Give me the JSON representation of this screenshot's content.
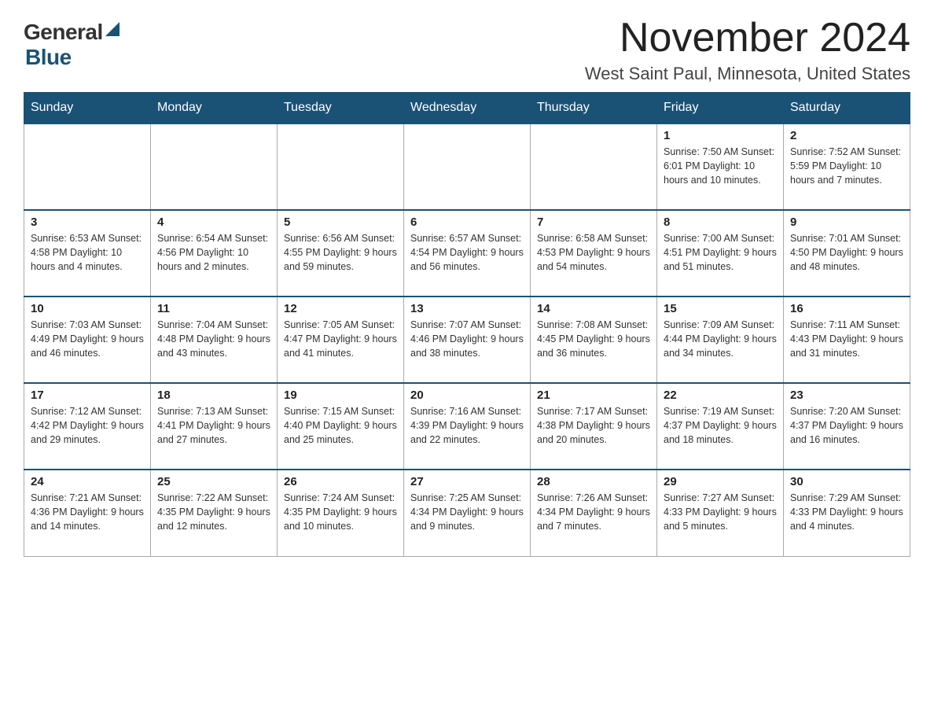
{
  "header": {
    "logo_general": "General",
    "logo_blue": "Blue",
    "month_title": "November 2024",
    "location": "West Saint Paul, Minnesota, United States"
  },
  "days_of_week": [
    "Sunday",
    "Monday",
    "Tuesday",
    "Wednesday",
    "Thursday",
    "Friday",
    "Saturday"
  ],
  "weeks": [
    [
      {
        "day": "",
        "info": ""
      },
      {
        "day": "",
        "info": ""
      },
      {
        "day": "",
        "info": ""
      },
      {
        "day": "",
        "info": ""
      },
      {
        "day": "",
        "info": ""
      },
      {
        "day": "1",
        "info": "Sunrise: 7:50 AM\nSunset: 6:01 PM\nDaylight: 10 hours\nand 10 minutes."
      },
      {
        "day": "2",
        "info": "Sunrise: 7:52 AM\nSunset: 5:59 PM\nDaylight: 10 hours\nand 7 minutes."
      }
    ],
    [
      {
        "day": "3",
        "info": "Sunrise: 6:53 AM\nSunset: 4:58 PM\nDaylight: 10 hours\nand 4 minutes."
      },
      {
        "day": "4",
        "info": "Sunrise: 6:54 AM\nSunset: 4:56 PM\nDaylight: 10 hours\nand 2 minutes."
      },
      {
        "day": "5",
        "info": "Sunrise: 6:56 AM\nSunset: 4:55 PM\nDaylight: 9 hours\nand 59 minutes."
      },
      {
        "day": "6",
        "info": "Sunrise: 6:57 AM\nSunset: 4:54 PM\nDaylight: 9 hours\nand 56 minutes."
      },
      {
        "day": "7",
        "info": "Sunrise: 6:58 AM\nSunset: 4:53 PM\nDaylight: 9 hours\nand 54 minutes."
      },
      {
        "day": "8",
        "info": "Sunrise: 7:00 AM\nSunset: 4:51 PM\nDaylight: 9 hours\nand 51 minutes."
      },
      {
        "day": "9",
        "info": "Sunrise: 7:01 AM\nSunset: 4:50 PM\nDaylight: 9 hours\nand 48 minutes."
      }
    ],
    [
      {
        "day": "10",
        "info": "Sunrise: 7:03 AM\nSunset: 4:49 PM\nDaylight: 9 hours\nand 46 minutes."
      },
      {
        "day": "11",
        "info": "Sunrise: 7:04 AM\nSunset: 4:48 PM\nDaylight: 9 hours\nand 43 minutes."
      },
      {
        "day": "12",
        "info": "Sunrise: 7:05 AM\nSunset: 4:47 PM\nDaylight: 9 hours\nand 41 minutes."
      },
      {
        "day": "13",
        "info": "Sunrise: 7:07 AM\nSunset: 4:46 PM\nDaylight: 9 hours\nand 38 minutes."
      },
      {
        "day": "14",
        "info": "Sunrise: 7:08 AM\nSunset: 4:45 PM\nDaylight: 9 hours\nand 36 minutes."
      },
      {
        "day": "15",
        "info": "Sunrise: 7:09 AM\nSunset: 4:44 PM\nDaylight: 9 hours\nand 34 minutes."
      },
      {
        "day": "16",
        "info": "Sunrise: 7:11 AM\nSunset: 4:43 PM\nDaylight: 9 hours\nand 31 minutes."
      }
    ],
    [
      {
        "day": "17",
        "info": "Sunrise: 7:12 AM\nSunset: 4:42 PM\nDaylight: 9 hours\nand 29 minutes."
      },
      {
        "day": "18",
        "info": "Sunrise: 7:13 AM\nSunset: 4:41 PM\nDaylight: 9 hours\nand 27 minutes."
      },
      {
        "day": "19",
        "info": "Sunrise: 7:15 AM\nSunset: 4:40 PM\nDaylight: 9 hours\nand 25 minutes."
      },
      {
        "day": "20",
        "info": "Sunrise: 7:16 AM\nSunset: 4:39 PM\nDaylight: 9 hours\nand 22 minutes."
      },
      {
        "day": "21",
        "info": "Sunrise: 7:17 AM\nSunset: 4:38 PM\nDaylight: 9 hours\nand 20 minutes."
      },
      {
        "day": "22",
        "info": "Sunrise: 7:19 AM\nSunset: 4:37 PM\nDaylight: 9 hours\nand 18 minutes."
      },
      {
        "day": "23",
        "info": "Sunrise: 7:20 AM\nSunset: 4:37 PM\nDaylight: 9 hours\nand 16 minutes."
      }
    ],
    [
      {
        "day": "24",
        "info": "Sunrise: 7:21 AM\nSunset: 4:36 PM\nDaylight: 9 hours\nand 14 minutes."
      },
      {
        "day": "25",
        "info": "Sunrise: 7:22 AM\nSunset: 4:35 PM\nDaylight: 9 hours\nand 12 minutes."
      },
      {
        "day": "26",
        "info": "Sunrise: 7:24 AM\nSunset: 4:35 PM\nDaylight: 9 hours\nand 10 minutes."
      },
      {
        "day": "27",
        "info": "Sunrise: 7:25 AM\nSunset: 4:34 PM\nDaylight: 9 hours\nand 9 minutes."
      },
      {
        "day": "28",
        "info": "Sunrise: 7:26 AM\nSunset: 4:34 PM\nDaylight: 9 hours\nand 7 minutes."
      },
      {
        "day": "29",
        "info": "Sunrise: 7:27 AM\nSunset: 4:33 PM\nDaylight: 9 hours\nand 5 minutes."
      },
      {
        "day": "30",
        "info": "Sunrise: 7:29 AM\nSunset: 4:33 PM\nDaylight: 9 hours\nand 4 minutes."
      }
    ]
  ]
}
